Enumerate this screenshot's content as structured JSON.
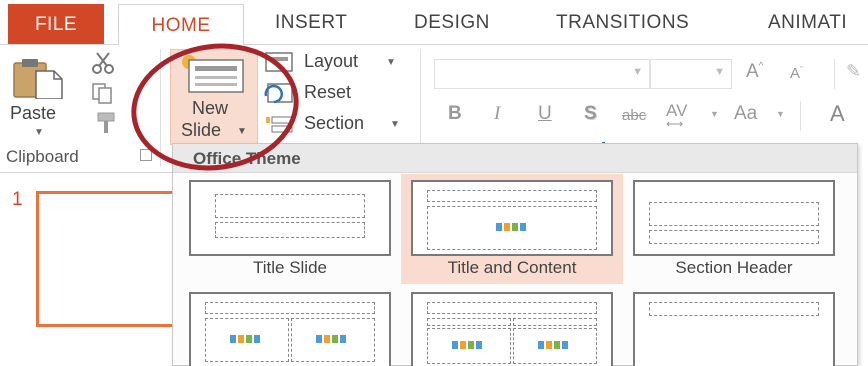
{
  "tabs": [
    "FILE",
    "HOME",
    "INSERT",
    "DESIGN",
    "TRANSITIONS",
    "ANIMATI"
  ],
  "clipboard": {
    "paste_label": "Paste",
    "group_label": "Clipboard"
  },
  "slides": {
    "new_slide_line1": "New",
    "new_slide_line2": "Slide",
    "layout_label": "Layout",
    "reset_label": "Reset",
    "section_label": "Section"
  },
  "font": {
    "bold": "B",
    "italic": "I",
    "underline": "U",
    "shadow": "S",
    "strikethrough": "abc",
    "spacing": "AV",
    "change_case": "Aa",
    "grow": "A",
    "shrink": "A",
    "color": "A"
  },
  "slide_pane": {
    "slide_number": "1"
  },
  "layout_gallery": {
    "header": "Office Theme",
    "layouts": [
      {
        "name": "Title Slide"
      },
      {
        "name": "Title and Content"
      },
      {
        "name": "Section Header"
      }
    ]
  },
  "colors": {
    "accent": "#d24726",
    "highlight_circle": "#a8242b",
    "selected_layout": "#f9dccf"
  }
}
